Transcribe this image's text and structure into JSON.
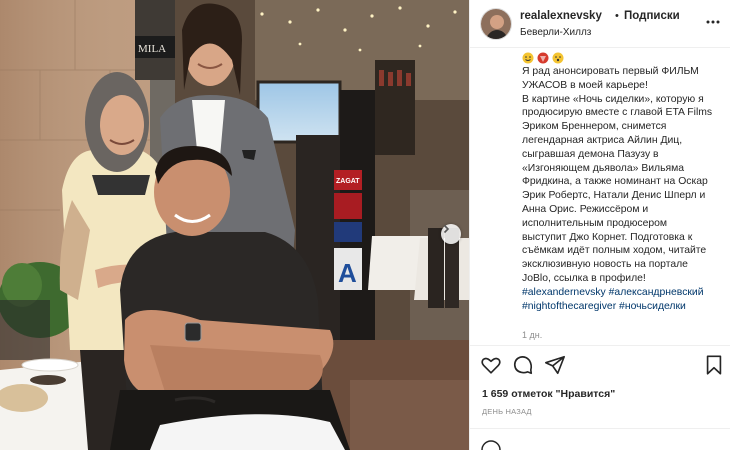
{
  "post": {
    "username": "realalexnevsky",
    "separator": "•",
    "follow_label": "Подписки",
    "location": "Беверли-Хиллз",
    "caption_lines": [
      "Я рад анонсировать первый ФИЛЬМ",
      "УЖАСОВ в моей карьере!",
      "В картине «Ночь сиделки», которую я",
      "продюсирую вместе с главой ETA Films",
      "Эриком Бреннером, снимется",
      "легендарная актриса Айлин Диц,",
      "сыгравшая демона Пазузу в",
      "«Изгоняющем дьявола» Вильяма",
      "Фридкина, а также номинант на Оскар",
      "Эрик Робертс, Натали Денис Шперл и",
      "Анна Орис. Режиссёром и",
      "исполнительным продюсером",
      "выступит Джо Корнет. Подготовка к",
      "съёмкам идёт полным ходом, читайте",
      "эксклюзивную новость на портале",
      "JoBlo, ссылка в профиле!"
    ],
    "hashtags": [
      "#alexandernevsky",
      "#александрневский",
      "#nightofthecaregiver",
      "#ночьсиделки"
    ],
    "caption_age": "1 дн.",
    "likes": "1 659 отметок \"Нравится\"",
    "timestamp": "ДЕНЬ НАЗАД"
  },
  "photo": {
    "sign_text": "MILA",
    "zagat_text": "ZAGAT",
    "icons": [
      "chevron-right-icon"
    ]
  },
  "actions": {
    "icons": [
      "heart-icon",
      "comment-icon",
      "share-icon",
      "bookmark-icon"
    ]
  },
  "colors": {
    "text": "#262626",
    "link": "#00376b",
    "muted": "#8e8e8e",
    "border": "#efefef"
  }
}
